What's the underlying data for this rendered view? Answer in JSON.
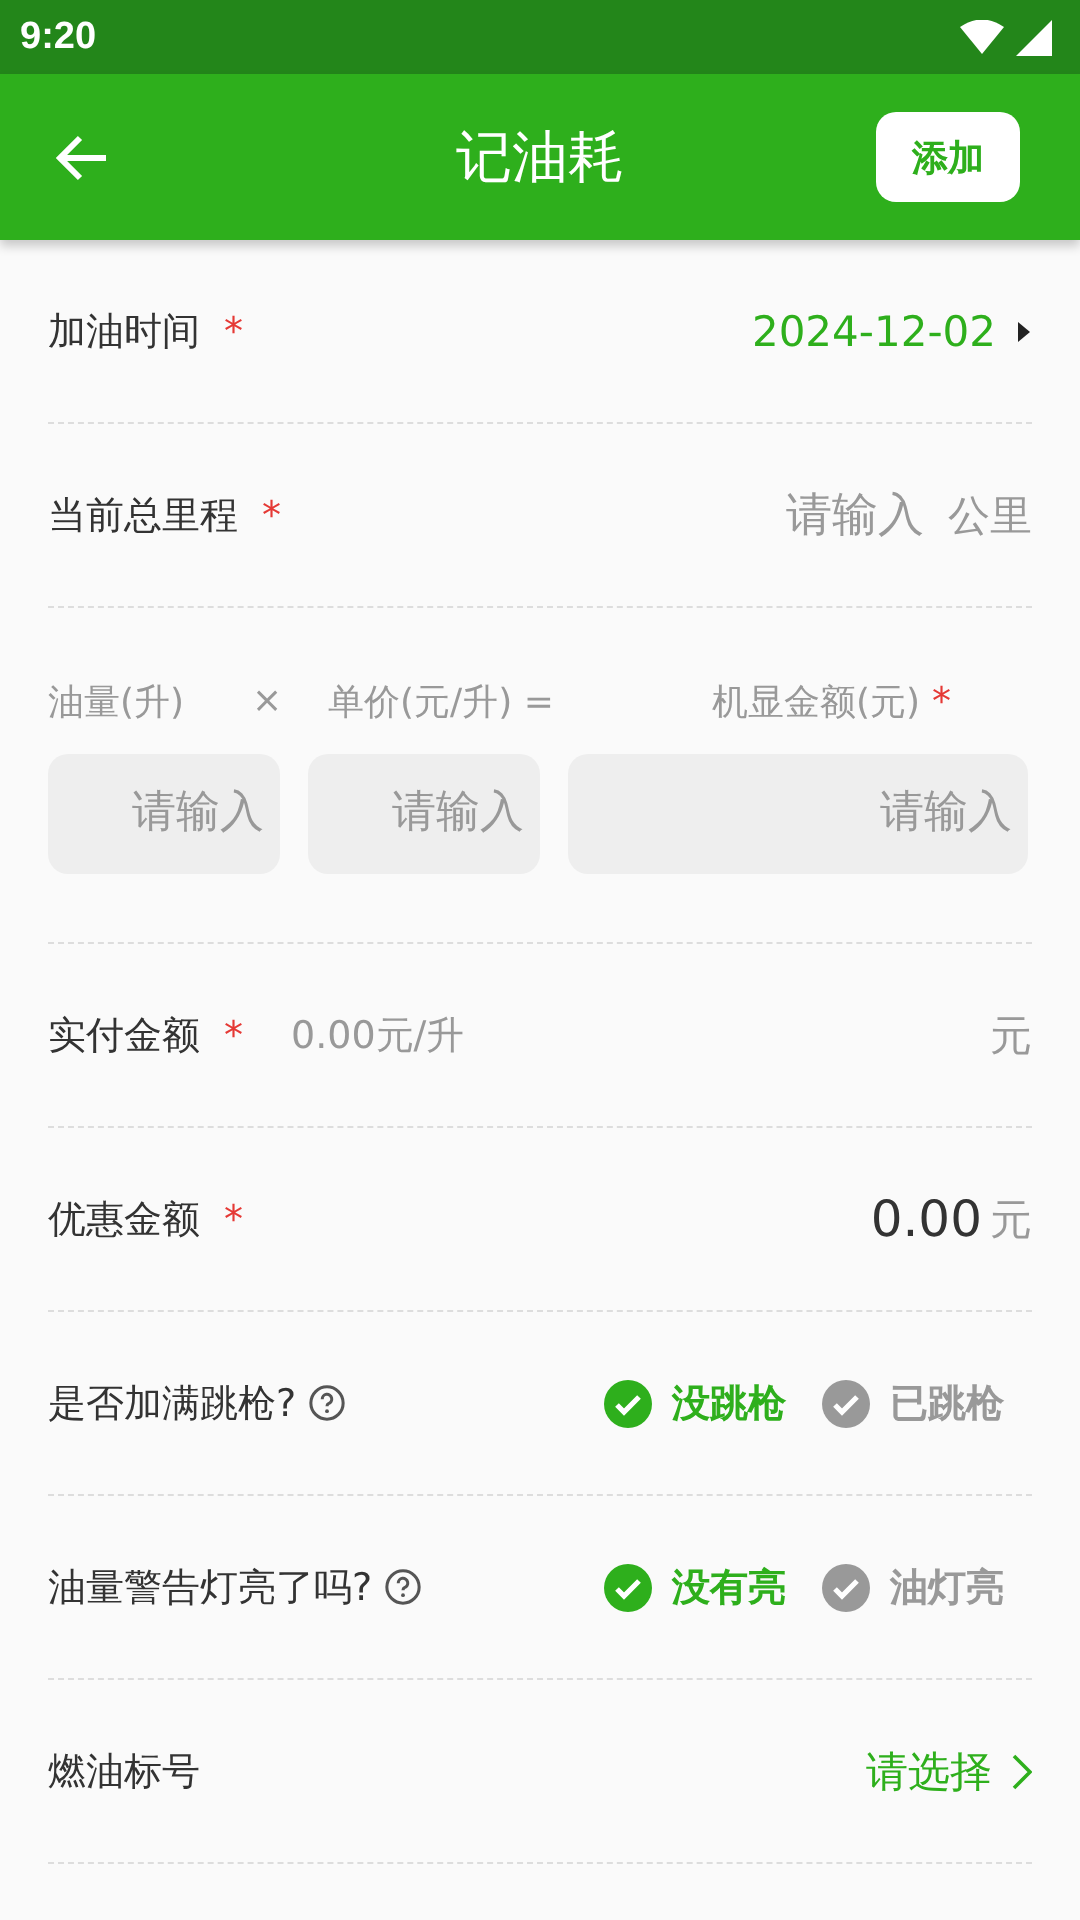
{
  "status_bar": {
    "time": "9:20"
  },
  "app_bar": {
    "title": "记油耗",
    "action": "添加"
  },
  "form": [
    {
      "kind": "picker",
      "label": "加油时间",
      "required_mark": "*",
      "value": "2024-12-02"
    },
    {
      "kind": "input",
      "label": "当前总里程",
      "required_mark": "*",
      "placeholder": "请输入",
      "unit": "公里"
    },
    {
      "kind": "calc",
      "labels": [
        "油量(升)",
        "×",
        "单价(元/升) =",
        "机显金额(元)"
      ],
      "required_mark": "*",
      "placeholders": [
        "请输入",
        "请输入",
        "请输入"
      ]
    },
    {
      "kind": "amount",
      "label": "实付金额",
      "required_mark": "*",
      "hint": "0.00元/升",
      "unit": "元"
    },
    {
      "kind": "value",
      "label": "优惠金额",
      "required_mark": "*",
      "value": "0.00",
      "unit": "元"
    },
    {
      "kind": "choice",
      "label": "是否加满跳枪?",
      "options": [
        {
          "label": "没跳枪",
          "selected": true
        },
        {
          "label": "已跳枪",
          "selected": false
        }
      ]
    },
    {
      "kind": "choice",
      "label": "油量警告灯亮了吗?",
      "options": [
        {
          "label": "没有亮",
          "selected": true
        },
        {
          "label": "油灯亮",
          "selected": false
        }
      ]
    },
    {
      "kind": "link",
      "label": "燃油标号",
      "value": "请选择"
    }
  ]
}
